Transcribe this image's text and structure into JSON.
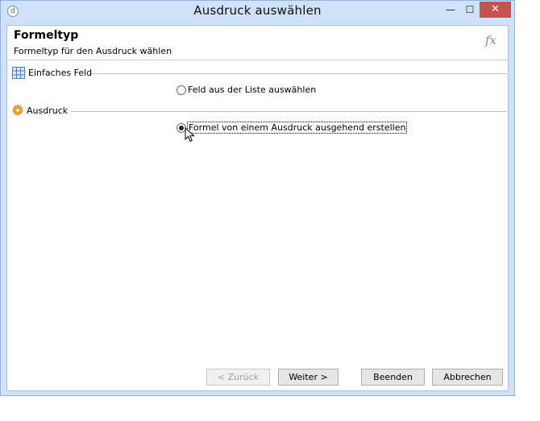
{
  "window": {
    "title": "Ausdruck auswählen",
    "controls": {
      "minimize": "—",
      "maximize": "☐",
      "close": "✕"
    }
  },
  "header": {
    "title": "Formeltyp",
    "subtitle": "Formeltyp für den Ausdruck wählen",
    "icon_text": "fx"
  },
  "sections": {
    "simple_field": {
      "label": "Einfaches Feld",
      "option_label": "Feld aus der Liste auswählen",
      "selected": false
    },
    "expression": {
      "label": "Ausdruck",
      "option_label": "Formel von einem Ausdruck ausgehend erstellen",
      "selected": true
    }
  },
  "footer": {
    "back_label": "< Zurück",
    "next_label": "Weiter >",
    "finish_label": "Beenden",
    "cancel_label": "Abbrechen"
  },
  "colors": {
    "frame": "#cfe2f7",
    "close_button": "#c75050",
    "gear_icon": "#f5a623",
    "grid_icon": "#4a7ebb"
  },
  "icons": [
    "app-icon",
    "fx-icon",
    "grid-icon",
    "gear-icon",
    "mouse-cursor-icon"
  ]
}
